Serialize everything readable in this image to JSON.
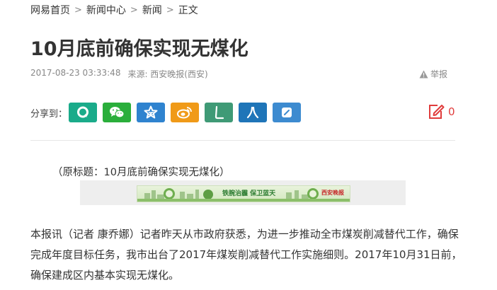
{
  "breadcrumb": {
    "items": [
      "网易首页",
      "新闻中心",
      "新闻",
      "正文"
    ],
    "separator": ">"
  },
  "article": {
    "title": "10月底前确保实现无煤化",
    "date": "2017-08-23 03:33:48",
    "source": "来源: 西安晚报(西安)",
    "report_label": "举报",
    "original_title": "（原标题：10月底前确保实现无煤化）",
    "body": "本报讯（记者 康乔娜）记者昨天从市政府获悉，为进一步推动全市煤炭削减替代工作，确保完成年度目标任务，我市出台了2017年煤炭削减替代工作实施细则。2017年10月31日前，确保建成区内基本实现无煤化。"
  },
  "share": {
    "label": "分享到：",
    "buttons": [
      {
        "icon": "yixin-icon",
        "color": "#1aab8a"
      },
      {
        "icon": "wechat-icon",
        "color": "#2aae3b"
      },
      {
        "icon": "qzone-star-icon",
        "color": "#2f83cf"
      },
      {
        "icon": "weibo-icon",
        "color": "#f09a18"
      },
      {
        "icon": "lofter-icon",
        "color": "#3f9a76"
      },
      {
        "icon": "renren-icon",
        "color": "#1f75b8"
      },
      {
        "icon": "youdao-note-icon",
        "color": "#3d8bd0"
      }
    ]
  },
  "comments": {
    "count": "0",
    "color": "#e03c3c"
  },
  "banner": {
    "slogan": "铁腕治霾 保卫蓝天",
    "brand": "西安晚报"
  }
}
